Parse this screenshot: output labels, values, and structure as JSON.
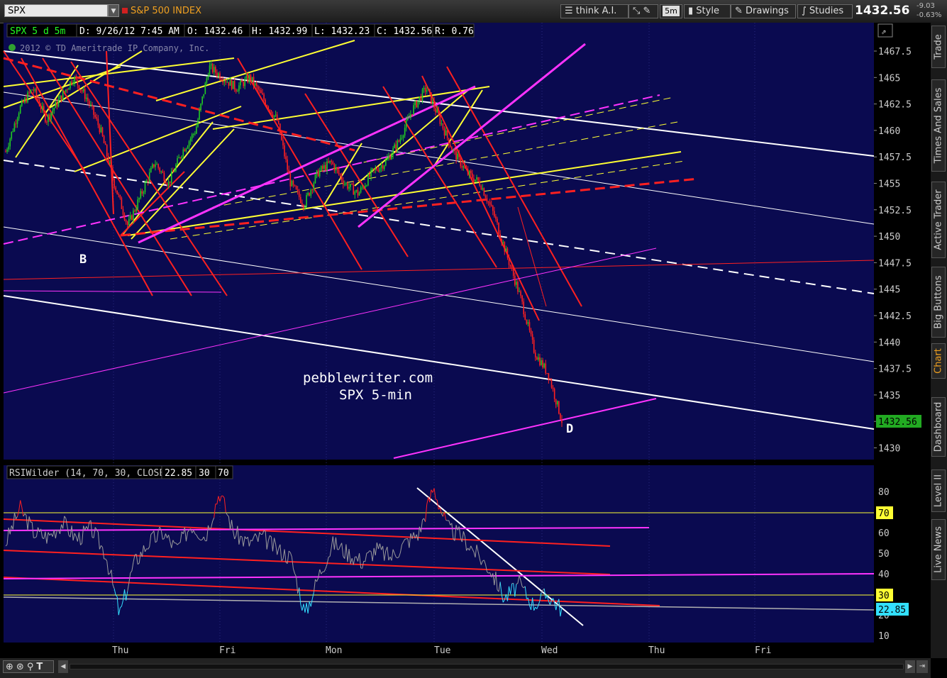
{
  "toolbar": {
    "symbol": "SPX",
    "symbol_name": "S&P 500 INDEX",
    "think_ai": "think A.I.",
    "aggregation": "5m",
    "style": "Style",
    "drawings": "Drawings",
    "studies": "Studies",
    "last_price": "1432.56",
    "net_change": "-9.03",
    "pct_change": "-0.63%"
  },
  "chart_header": {
    "label": "SPX 5 d 5m",
    "date": "D: 9/26/12 7:45 AM",
    "open": "O: 1432.46",
    "high": "H: 1432.99",
    "low": "L: 1432.23",
    "close": "C: 1432.56",
    "range": "R: 0.76",
    "copyright": "2012 © TD Ameritrade IP Company, Inc."
  },
  "annotations": {
    "watermark_line1": "pebblewriter.com",
    "watermark_line2": "SPX 5-min",
    "label_b": "B",
    "label_d": "D"
  },
  "price_axis": {
    "ticks": [
      "1467.5",
      "1465",
      "1462.5",
      "1460",
      "1457.5",
      "1455",
      "1452.5",
      "1450",
      "1447.5",
      "1445",
      "1442.5",
      "1440",
      "1437.5",
      "1435",
      "1432.5",
      "1430"
    ],
    "current_label": "1432.56"
  },
  "rsi": {
    "header": "RSIWilder (14, 70, 30, CLOSE)",
    "value": "22.85",
    "over_bought": "30",
    "over_sold": "70",
    "ticks": [
      "80",
      "70",
      "60",
      "50",
      "40",
      "30",
      "20",
      "10"
    ],
    "label_70": "70",
    "label_30": "30",
    "current_label": "22.85"
  },
  "time_axis": [
    "Thu",
    "Fri",
    "Mon",
    "Tue",
    "Wed",
    "Thu",
    "Fri"
  ],
  "sidebar": [
    "Trade",
    "Times And Sales",
    "Active Trader",
    "Big Buttons",
    "Chart",
    "Dashboard",
    "Level II",
    "Live News"
  ],
  "colors": {
    "bg": "#0a0a50",
    "yellow": "#ffff33",
    "red": "#ff2020",
    "magenta": "#ff33ff",
    "white": "#ffffff",
    "up": "#22cc22",
    "rsi_line": "#9a9a9a",
    "rsi_low": "#33e0ff"
  },
  "chart_data": {
    "type": "candlestick",
    "title": "SPX 5 d 5m",
    "ylim": [
      1429,
      1469
    ],
    "x_categories": [
      "Thu",
      "Fri",
      "Mon",
      "Tue",
      "Wed",
      "Thu",
      "Fri"
    ],
    "price_path": [
      1458,
      1462,
      1464,
      1461,
      1463,
      1465,
      1463,
      1460,
      1455,
      1451,
      1454,
      1457,
      1455,
      1458,
      1460,
      1466,
      1465,
      1464,
      1465,
      1463,
      1461,
      1455,
      1453,
      1456,
      1457,
      1455,
      1454,
      1456,
      1457,
      1459,
      1462,
      1464,
      1461,
      1458,
      1456,
      1455,
      1452,
      1448,
      1444,
      1439,
      1437,
      1432.56
    ],
    "last": 1432.56,
    "rsi_ylim": [
      10,
      85
    ],
    "rsi_overbought": 70,
    "rsi_oversold": 30,
    "rsi_last": 22.85,
    "rsi_path": [
      55,
      72,
      60,
      58,
      65,
      57,
      62,
      50,
      20,
      45,
      55,
      60,
      52,
      64,
      58,
      80,
      60,
      55,
      58,
      52,
      48,
      20,
      40,
      55,
      50,
      46,
      52,
      48,
      55,
      60,
      82,
      62,
      58,
      50,
      42,
      28,
      35,
      25,
      30,
      22.85
    ]
  }
}
